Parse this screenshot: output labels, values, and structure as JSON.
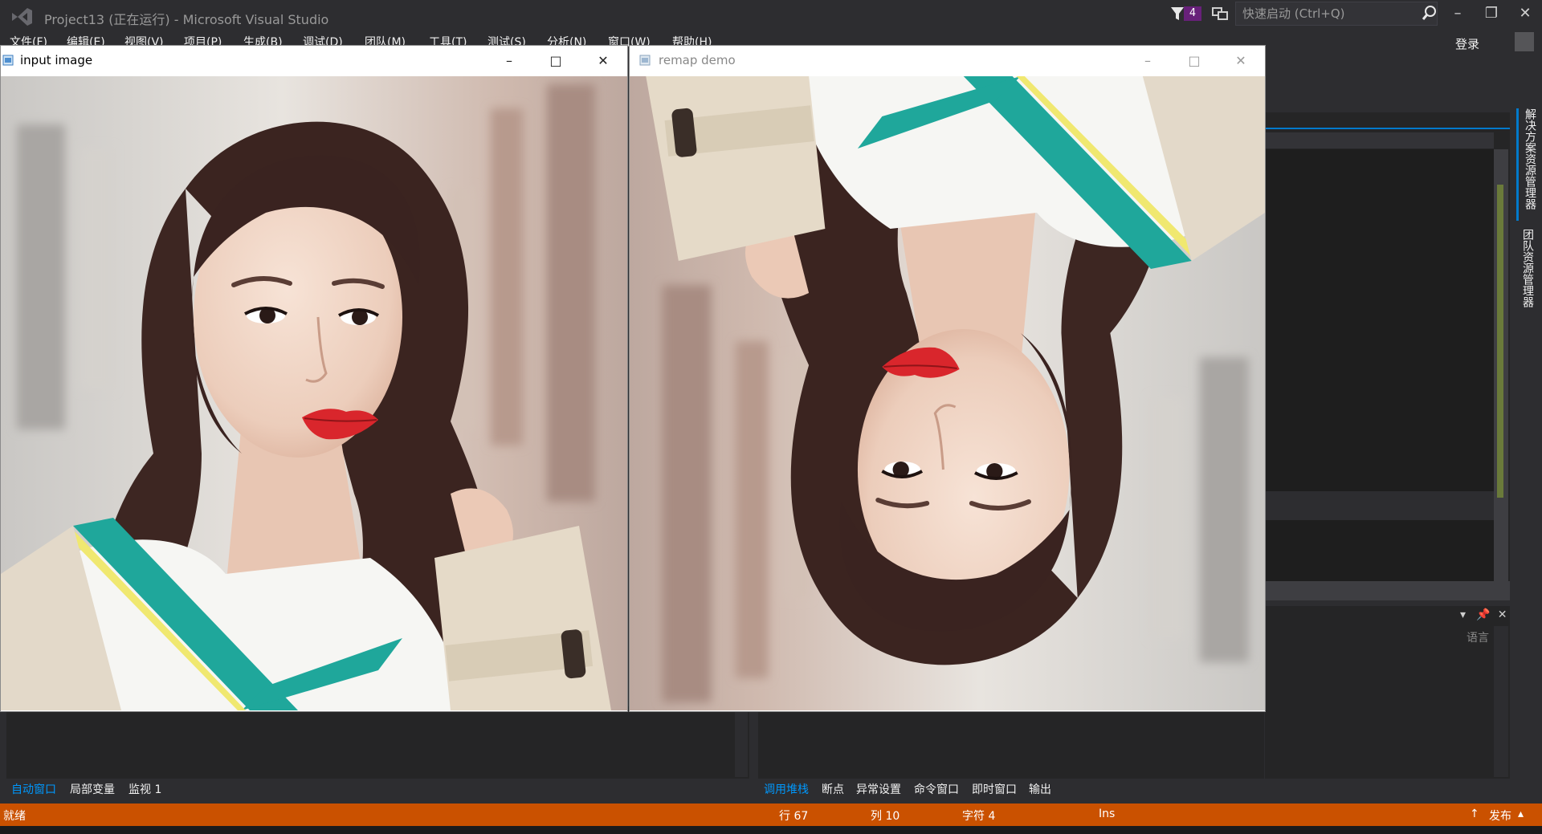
{
  "vs": {
    "title": "Project13 (正在运行) - Microsoft Visual Studio",
    "notification_count": "4",
    "quick_launch_placeholder": "快速启动 (Ctrl+Q)",
    "menu": [
      "文件(F)",
      "编辑(E)",
      "视图(V)",
      "项目(P)",
      "生成(B)",
      "调试(D)",
      "团队(M)",
      "工具(T)",
      "测试(S)",
      "分析(N)",
      "窗口(W)",
      "帮助(H)"
    ],
    "login": "登录",
    "side_tabs": [
      "解决方案资源管理器",
      "团队资源管理器"
    ],
    "language_label": "语言",
    "left_tabs": [
      "自动窗口",
      "局部变量",
      "监视 1"
    ],
    "right_tabs": [
      "调用堆栈",
      "断点",
      "异常设置",
      "命令窗口",
      "即时窗口",
      "输出"
    ],
    "status": {
      "ready": "就绪",
      "line": "行 67",
      "col": "列 10",
      "char": "字符 4",
      "mode": "Ins",
      "publish": "发布"
    }
  },
  "windows": {
    "input": {
      "title": "input image"
    },
    "remap": {
      "title": "remap demo"
    }
  },
  "colors": {
    "vs_background": "#2d2d30",
    "status_bar": "#ca5100",
    "accent": "#007acc",
    "notification": "#68217a",
    "sweater_stripe": "#1fa79b"
  },
  "icons": {
    "vs_logo": "visual-studio-logo-icon",
    "filter": "filter-icon",
    "feedback": "feedback-icon",
    "search": "search-icon",
    "minimize": "minimize-icon",
    "maximize": "maximize-icon",
    "close": "close-icon",
    "window_app": "opencv-window-icon",
    "publish": "arrow-up-icon"
  }
}
